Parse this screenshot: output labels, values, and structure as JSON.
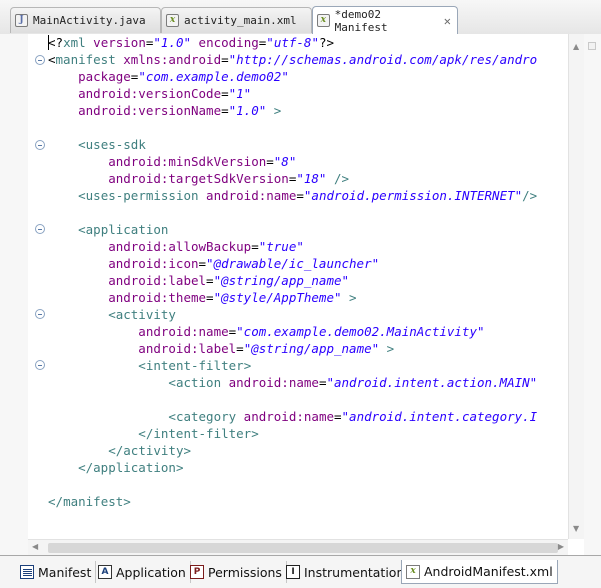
{
  "tabs": [
    {
      "label": "MainActivity.java",
      "icon": "java-file-icon",
      "active": false
    },
    {
      "label": "activity_main.xml",
      "icon": "xml-file-icon",
      "active": false
    },
    {
      "label": "*demo02 Manifest",
      "icon": "xml-file-icon",
      "active": true
    }
  ],
  "code": {
    "l01": {
      "p1": "<?",
      "t1": "xml",
      "a1": " version",
      "p2": "=",
      "v1": "\"1.0\"",
      "a2": " encoding",
      "p3": "=",
      "v2": "\"utf-8\"",
      "p4": "?>"
    },
    "l02": {
      "p1": "<",
      "t1": "manifest",
      "a1": " xmlns:android",
      "p2": "=",
      "v1": "\"http://schemas.android.com/apk/res/andro"
    },
    "l03": {
      "a1": "    package",
      "p1": "=",
      "v1": "\"com.example.demo02\""
    },
    "l04": {
      "a1": "    android:versionCode",
      "p1": "=",
      "v1": "\"1\""
    },
    "l05": {
      "a1": "    android:versionName",
      "p1": "=",
      "v1": "\"1.0\"",
      "p2": " >"
    },
    "l07": {
      "p1": "    <",
      "t1": "uses-sdk"
    },
    "l08": {
      "a1": "        android:minSdkVersion",
      "p1": "=",
      "v1": "\"8\""
    },
    "l09": {
      "a1": "        android:targetSdkVersion",
      "p1": "=",
      "v1": "\"18\"",
      "p2": " />"
    },
    "l10": {
      "p1": "    <",
      "t1": "uses-permission",
      "a1": " android:name",
      "p2": "=",
      "v1": "\"android.permission.INTERNET\"",
      "p3": "/>"
    },
    "l12": {
      "p1": "    <",
      "t1": "application"
    },
    "l13": {
      "a1": "        android:allowBackup",
      "p1": "=",
      "v1": "\"true\""
    },
    "l14": {
      "a1": "        android:icon",
      "p1": "=",
      "v1": "\"@drawable/ic_launcher\""
    },
    "l15": {
      "a1": "        android:label",
      "p1": "=",
      "v1": "\"@string/app_name\""
    },
    "l16": {
      "a1": "        android:theme",
      "p1": "=",
      "v1": "\"@style/AppTheme\"",
      "p2": " >"
    },
    "l17": {
      "p1": "        <",
      "t1": "activity"
    },
    "l18": {
      "a1": "            android:name",
      "p1": "=",
      "v1": "\"com.example.demo02.MainActivity\""
    },
    "l19": {
      "a1": "            android:label",
      "p1": "=",
      "v1": "\"@string/app_name\"",
      "p2": " >"
    },
    "l20": {
      "p1": "            <",
      "t1": "intent-filter",
      "p2": ">"
    },
    "l21": {
      "p1": "                <",
      "t1": "action",
      "a1": " android:name",
      "p2": "=",
      "v1": "\"android.intent.action.MAIN\""
    },
    "l23": {
      "p1": "                <",
      "t1": "category",
      "a1": " android:name",
      "p2": "=",
      "v1": "\"android.intent.category.I"
    },
    "l24": {
      "p1": "            </",
      "t1": "intent-filter",
      "p2": ">"
    },
    "l25": {
      "p1": "        </",
      "t1": "activity",
      "p2": ">"
    },
    "l26": {
      "p1": "    </",
      "t1": "application",
      "p2": ">"
    },
    "l28": {
      "p1": "</",
      "t1": "manifest",
      "p2": ">"
    }
  },
  "bottom_tabs": [
    {
      "label": "Manifest",
      "icon": "manifest-icon",
      "active": false
    },
    {
      "label": "Application",
      "icon": "application-icon",
      "glyph": "A",
      "active": false
    },
    {
      "label": "Permissions",
      "icon": "permissions-icon",
      "glyph": "P",
      "active": false
    },
    {
      "label": "Instrumentation",
      "icon": "instrumentation-icon",
      "glyph": "I",
      "active": false
    },
    {
      "label": "AndroidManifest.xml",
      "icon": "xml-file-icon",
      "active": true
    }
  ],
  "colors": {
    "tag": "#3f7f7f",
    "attribute": "#7f007f",
    "value": "#2a00ff"
  }
}
